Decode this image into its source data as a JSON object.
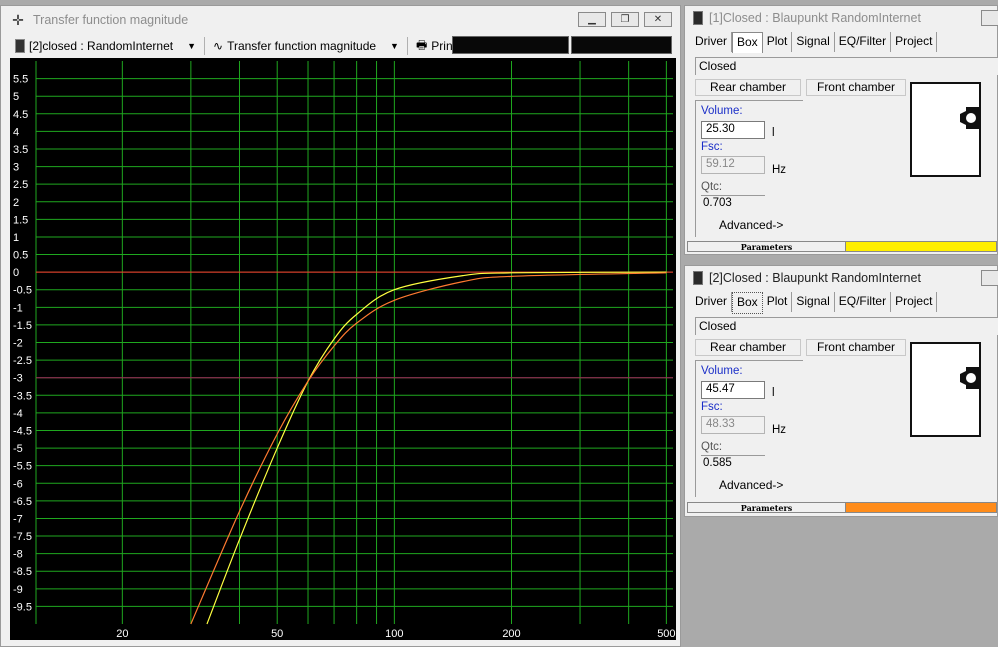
{
  "chart_window": {
    "title": "Transfer function magnitude",
    "project_dropdown": "[2]closed : RandomInternet",
    "view_dropdown": "Transfer function magnitude",
    "print_label": "Print"
  },
  "panels": [
    {
      "title": "[1]Closed : Blaupunkt RandomInternet",
      "tabs": [
        "Driver",
        "Box",
        "Plot",
        "Signal",
        "EQ/Filter",
        "Project"
      ],
      "active_tab": "Box",
      "box_type": "Closed",
      "rear_chamber_label": "Rear chamber",
      "front_chamber_label": "Front chamber",
      "volume_label": "Volume:",
      "volume_value": "25.30",
      "volume_unit": "l",
      "fsc_label": "Fsc:",
      "fsc_value": "59.12",
      "fsc_unit": "Hz",
      "qtc_label": "Qtc:",
      "qtc_value": "0.703",
      "advanced_label": "Advanced->",
      "status_label": "Parameters",
      "status_color": "#ffee00"
    },
    {
      "title": "[2]Closed : Blaupunkt RandomInternet",
      "tabs": [
        "Driver",
        "Box",
        "Plot",
        "Signal",
        "EQ/Filter",
        "Project"
      ],
      "active_tab": "Box",
      "box_type": "Closed",
      "rear_chamber_label": "Rear chamber",
      "front_chamber_label": "Front chamber",
      "volume_label": "Volume:",
      "volume_value": "45.47",
      "volume_unit": "l",
      "fsc_label": "Fsc:",
      "fsc_value": "48.33",
      "fsc_unit": "Hz",
      "qtc_label": "Qtc:",
      "qtc_value": "0.585",
      "advanced_label": "Advanced->",
      "status_label": "Parameters",
      "status_color": "#ff8c1a"
    }
  ],
  "chart_data": {
    "type": "line",
    "x_scale": "log",
    "xlim": [
      12,
      520
    ],
    "ylim": [
      -10,
      6
    ],
    "x_tick_labels": [
      "20",
      "50",
      "100",
      "200",
      "500"
    ],
    "x_ticks": [
      20,
      50,
      100,
      200,
      500
    ],
    "y_ticks": [
      5.5,
      5,
      4.5,
      4,
      3.5,
      3,
      2.5,
      2,
      1.5,
      1,
      0.5,
      0,
      -0.5,
      -1,
      -1.5,
      -2,
      -2.5,
      -3,
      -3.5,
      -4,
      -4.5,
      -5,
      -5.5,
      -6,
      -6.5,
      -7,
      -7.5,
      -8,
      -8.5,
      -9,
      -9.5
    ],
    "y_tick_labels": [
      "5.5",
      "5",
      "4.5",
      "4",
      "3.5",
      "3",
      "2.5",
      "2",
      "1.5",
      "1",
      "0.5",
      "0",
      "-0.5",
      "-1",
      "-1.5",
      "-2",
      "-2.5",
      "-3",
      "-3.5",
      "-4",
      "-4.5",
      "-5",
      "-5.5",
      "-6",
      "-6.5",
      "-7",
      "-7.5",
      "-8",
      "-8.5",
      "-9",
      "-9.5"
    ],
    "reference_lines": [
      {
        "y": 0,
        "color": "#ff3030"
      },
      {
        "y": -3,
        "color": "#a0205a"
      }
    ],
    "grid": true,
    "background": "#000000",
    "grid_color": "#1fa81f",
    "series": [
      {
        "color": "#ffff40",
        "points": [
          [
            33,
            -10
          ],
          [
            40,
            -7.6
          ],
          [
            50,
            -5.0
          ],
          [
            60,
            -3.1
          ],
          [
            70,
            -1.9
          ],
          [
            80,
            -1.2
          ],
          [
            100,
            -0.5
          ],
          [
            150,
            -0.1
          ],
          [
            200,
            -0.02
          ],
          [
            500,
            0
          ]
        ]
      },
      {
        "color": "#ff7a30",
        "points": [
          [
            30,
            -10
          ],
          [
            40,
            -6.8
          ],
          [
            50,
            -4.6
          ],
          [
            60,
            -3.1
          ],
          [
            70,
            -2.1
          ],
          [
            80,
            -1.45
          ],
          [
            100,
            -0.8
          ],
          [
            150,
            -0.27
          ],
          [
            200,
            -0.12
          ],
          [
            500,
            -0.02
          ]
        ]
      }
    ]
  }
}
